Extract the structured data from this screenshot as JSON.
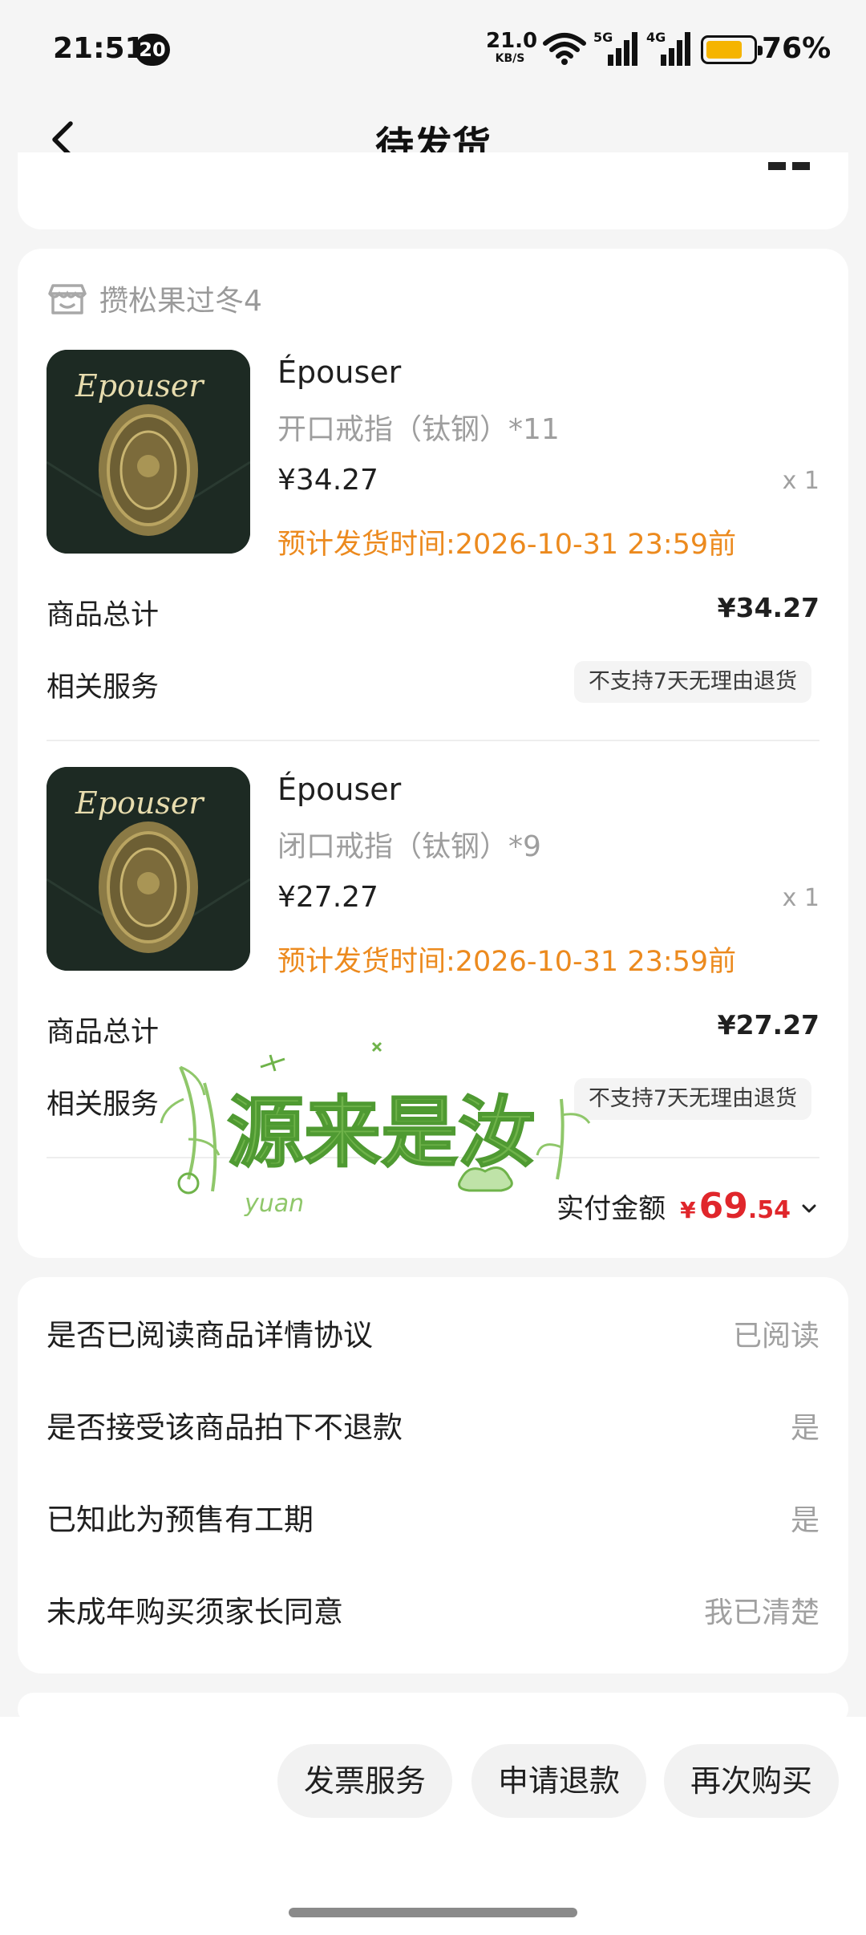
{
  "status_bar": {
    "time": "21:51",
    "notif_count": "20",
    "net_speed": "21.0",
    "net_unit": "KB/S",
    "sig1_label": "5G",
    "sig2_label": "4G",
    "battery_percent": "76%",
    "battery_level": 0.76,
    "battery_color": "#f5b400"
  },
  "nav": {
    "back_icon": "chevron-left-icon",
    "title": "待发货"
  },
  "shop": {
    "icon": "store-icon",
    "name": "攒松果过冬4"
  },
  "items": [
    {
      "title": "Épouser",
      "thumb_text": "Epouser",
      "sku": "开口戒指（钛钢）*11",
      "price": "¥34.27",
      "qty": "x 1",
      "ship_time": "预计发货时间:2026-10-31 23:59前",
      "subtotal_label": "商品总计",
      "subtotal_value": "¥34.27",
      "service_label": "相关服务",
      "service_tag": "不支持7天无理由退货"
    },
    {
      "title": "Épouser",
      "thumb_text": "Epouser",
      "sku": "闭口戒指（钛钢）*9",
      "price": "¥27.27",
      "qty": "x 1",
      "ship_time": "预计发货时间:2026-10-31 23:59前",
      "subtotal_label": "商品总计",
      "subtotal_value": "¥27.27",
      "service_label": "相关服务",
      "service_tag": "不支持7天无理由退货"
    }
  ],
  "total": {
    "label": "实付金额",
    "currency": "¥",
    "integer": "69",
    "decimal": ".54",
    "accent_color": "#e0262b"
  },
  "agreements": [
    {
      "label": "是否已阅读商品详情协议",
      "value": "已阅读"
    },
    {
      "label": "是否接受该商品拍下不退款",
      "value": "是"
    },
    {
      "label": "已知此为预售有工期",
      "value": "是"
    },
    {
      "label": "未成年购买须家长同意",
      "value": "我已清楚"
    }
  ],
  "sticker": {
    "text": "源来是汝",
    "sub": "yuan",
    "color": "#6fb34a"
  },
  "actions": {
    "invoice": "发票服务",
    "refund": "申请退款",
    "rebuy": "再次购买"
  },
  "colors": {
    "ship_time": "#ec8a1e",
    "background": "#f5f5f5"
  }
}
